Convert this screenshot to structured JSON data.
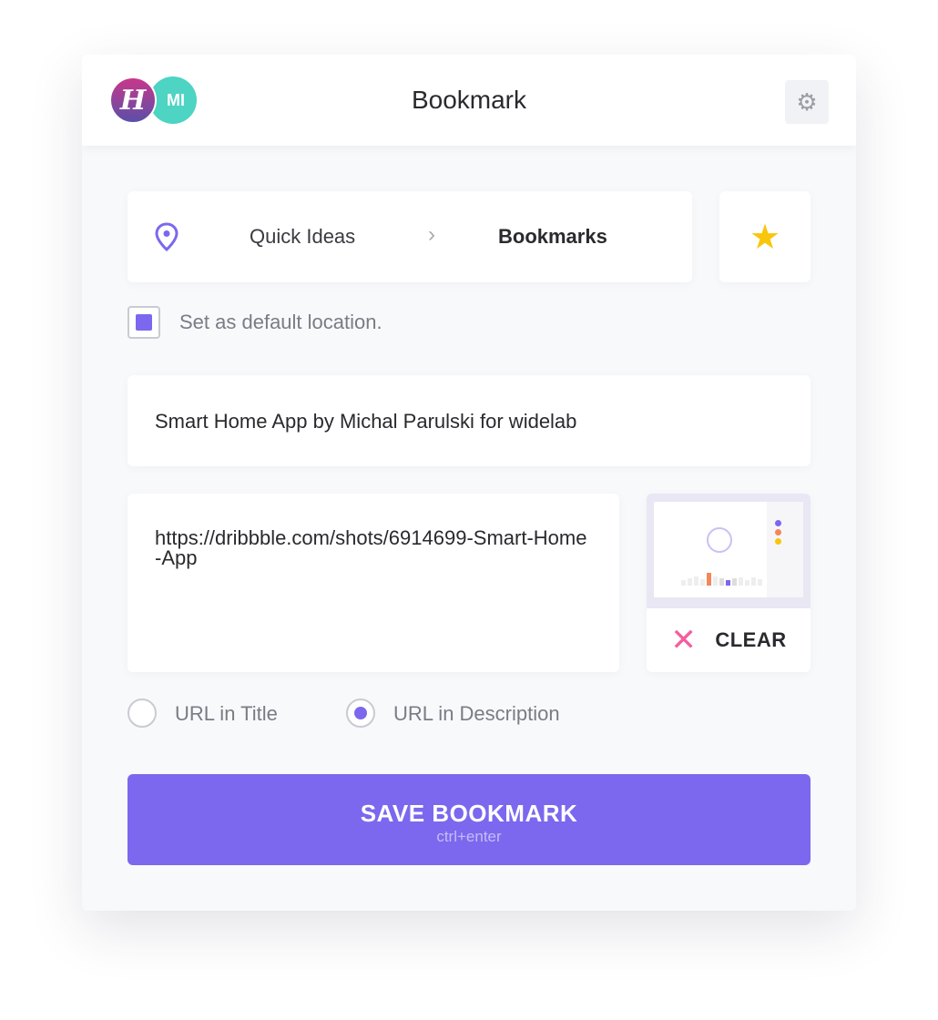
{
  "header": {
    "title": "Bookmark",
    "avatar_initials": "MI",
    "logo_letter": "H"
  },
  "location": {
    "space": "Quick Ideas",
    "list": "Bookmarks",
    "icon": "location-pin-icon"
  },
  "default_location": {
    "label": "Set as default location.",
    "checked": true
  },
  "bookmark_title": "Smart Home App by Michal Parulski for widelab",
  "bookmark_url": "https://dribbble.com/shots/6914699-Smart-Home-App",
  "thumbnail": {
    "clear_label": "CLEAR"
  },
  "url_options": [
    {
      "label": "URL in Title",
      "selected": false
    },
    {
      "label": "URL in Description",
      "selected": true
    }
  ],
  "save": {
    "label": "SAVE BOOKMARK",
    "shortcut": "ctrl+enter"
  },
  "colors": {
    "accent": "#7b68ee",
    "star": "#f8c60c",
    "clear": "#f55d9e",
    "avatar": "#4dd4c3"
  }
}
